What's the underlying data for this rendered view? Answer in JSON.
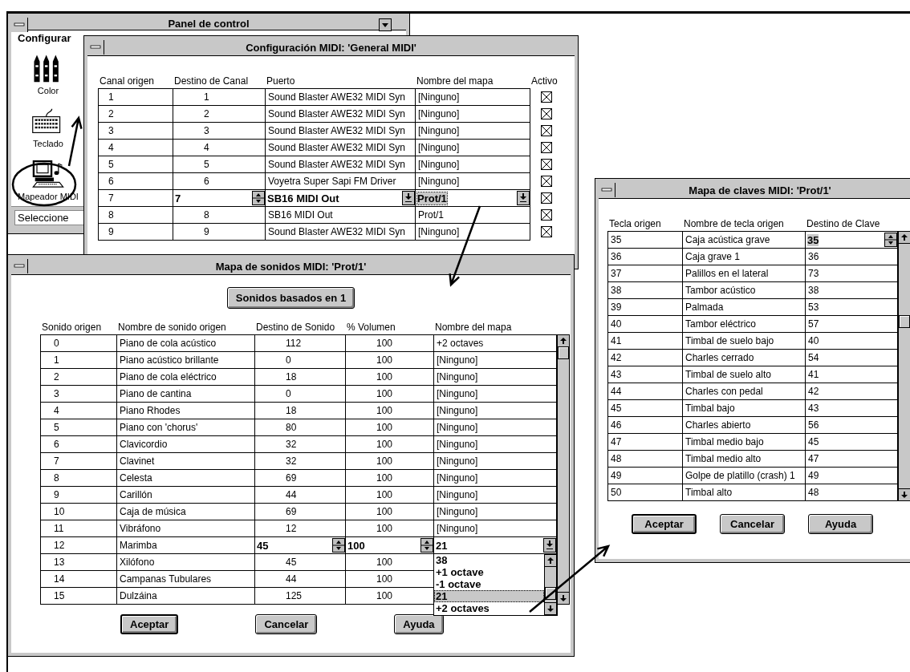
{
  "control_panel": {
    "title": "Panel de control",
    "menu": [
      {
        "label": "Configurar"
      }
    ],
    "icons": [
      {
        "label": "Color",
        "kind": "crayons"
      },
      {
        "label": "Teclado",
        "kind": "keyboard"
      },
      {
        "label": "Mapeador MIDI",
        "kind": "midi"
      }
    ],
    "status": "Seleccione"
  },
  "midi_setup": {
    "title": "Configuración MIDI: 'General MIDI'",
    "columns": [
      {
        "label": "Canal origen"
      },
      {
        "label": "Destino de Canal"
      },
      {
        "label": "Puerto"
      },
      {
        "label": "Nombre del mapa"
      },
      {
        "label": "Activo"
      }
    ],
    "rows": [
      {
        "source": "1",
        "dest": "1",
        "port": "Sound Blaster AWE32 MIDI Syn",
        "map": "[Ninguno]",
        "active": true,
        "editing": false
      },
      {
        "source": "2",
        "dest": "2",
        "port": "Sound Blaster AWE32 MIDI Syn",
        "map": "[Ninguno]",
        "active": true,
        "editing": false
      },
      {
        "source": "3",
        "dest": "3",
        "port": "Sound Blaster AWE32 MIDI Syn",
        "map": "[Ninguno]",
        "active": true,
        "editing": false
      },
      {
        "source": "4",
        "dest": "4",
        "port": "Sound Blaster AWE32 MIDI Syn",
        "map": "[Ninguno]",
        "active": true,
        "editing": false
      },
      {
        "source": "5",
        "dest": "5",
        "port": "Sound Blaster AWE32 MIDI Syn",
        "map": "[Ninguno]",
        "active": true,
        "editing": false
      },
      {
        "source": "6",
        "dest": "6",
        "port": "Voyetra Super Sapi FM Driver",
        "map": "[Ninguno]",
        "active": true,
        "editing": false
      },
      {
        "source": "7",
        "dest": "7",
        "port": "SB16 MIDI Out",
        "map": "Prot/1",
        "active": true,
        "editing": true
      },
      {
        "source": "8",
        "dest": "8",
        "port": "SB16 MIDI Out",
        "map": "Prot/1",
        "active": true,
        "editing": false
      },
      {
        "source": "9",
        "dest": "9",
        "port": "Sound Blaster AWE32 MIDI Syn",
        "map": "[Ninguno]",
        "active": true,
        "editing": false
      }
    ]
  },
  "sound_map": {
    "title": "Mapa de sonidos MIDI: 'Prot/1'",
    "base_button": {
      "label": "Sonidos basados en 1"
    },
    "columns": [
      {
        "label": "Sonido origen"
      },
      {
        "label": "Nombre de sonido origen"
      },
      {
        "label": "Destino de Sonido"
      },
      {
        "label": "% Volumen"
      },
      {
        "label": "Nombre del mapa"
      }
    ],
    "rows": [
      {
        "source": "0",
        "name": "Piano de cola acústico",
        "dest": "112",
        "volume": "100",
        "map": "+2 octaves",
        "editing": false
      },
      {
        "source": "1",
        "name": "Piano acústico brillante",
        "dest": "0",
        "volume": "100",
        "map": "[Ninguno]",
        "editing": false
      },
      {
        "source": "2",
        "name": "Piano de cola eléctrico",
        "dest": "18",
        "volume": "100",
        "map": "[Ninguno]",
        "editing": false
      },
      {
        "source": "3",
        "name": "Piano de cantina",
        "dest": "0",
        "volume": "100",
        "map": "[Ninguno]",
        "editing": false
      },
      {
        "source": "4",
        "name": "Piano Rhodes",
        "dest": "18",
        "volume": "100",
        "map": "[Ninguno]",
        "editing": false
      },
      {
        "source": "5",
        "name": "Piano con 'chorus'",
        "dest": "80",
        "volume": "100",
        "map": "[Ninguno]",
        "editing": false
      },
      {
        "source": "6",
        "name": "Clavicordio",
        "dest": "32",
        "volume": "100",
        "map": "[Ninguno]",
        "editing": false
      },
      {
        "source": "7",
        "name": "Clavinet",
        "dest": "32",
        "volume": "100",
        "map": "[Ninguno]",
        "editing": false
      },
      {
        "source": "8",
        "name": "Celesta",
        "dest": "69",
        "volume": "100",
        "map": "[Ninguno]",
        "editing": false
      },
      {
        "source": "9",
        "name": "Carillón",
        "dest": "44",
        "volume": "100",
        "map": "[Ninguno]",
        "editing": false
      },
      {
        "source": "10",
        "name": "Caja de música",
        "dest": "69",
        "volume": "100",
        "map": "[Ninguno]",
        "editing": false
      },
      {
        "source": "11",
        "name": "Vibráfono",
        "dest": "12",
        "volume": "100",
        "map": "[Ninguno]",
        "editing": false
      },
      {
        "source": "12",
        "name": "Marimba",
        "dest": "45",
        "volume": "100",
        "map": "21",
        "editing": true,
        "dropdown": [
          {
            "label": "38",
            "selected": false
          },
          {
            "label": "+1 octave",
            "selected": false
          },
          {
            "label": "-1 octave",
            "selected": false
          },
          {
            "label": "21",
            "selected": true
          },
          {
            "label": "+2 octaves",
            "selected": false
          }
        ]
      },
      {
        "source": "13",
        "name": "Xilófono",
        "dest": "45",
        "volume": "100",
        "editing": false
      },
      {
        "source": "14",
        "name": "Campanas Tubulares",
        "dest": "44",
        "volume": "100",
        "editing": false
      },
      {
        "source": "15",
        "name": "Dulzáina",
        "dest": "125",
        "volume": "100",
        "editing": false
      }
    ],
    "buttons": [
      {
        "label": "Aceptar",
        "default": true
      },
      {
        "label": "Cancelar",
        "default": false
      },
      {
        "label": "Ayuda",
        "default": false
      }
    ]
  },
  "key_map": {
    "title": "Mapa de claves MIDI: 'Prot/1'",
    "columns": [
      {
        "label": "Tecla origen"
      },
      {
        "label": "Nombre de tecla origen"
      },
      {
        "label": "Destino de Clave"
      }
    ],
    "rows": [
      {
        "source": "35",
        "name": "Caja acústica grave",
        "dest": "35",
        "editing": true
      },
      {
        "source": "36",
        "name": "Caja grave 1",
        "dest": "36",
        "editing": false
      },
      {
        "source": "37",
        "name": "Palillos en el lateral",
        "dest": "73",
        "editing": false
      },
      {
        "source": "38",
        "name": "Tambor acústico",
        "dest": "38",
        "editing": false
      },
      {
        "source": "39",
        "name": "Palmada",
        "dest": "53",
        "editing": false
      },
      {
        "source": "40",
        "name": "Tambor eléctrico",
        "dest": "57",
        "editing": false
      },
      {
        "source": "41",
        "name": "Timbal de suelo bajo",
        "dest": "40",
        "editing": false
      },
      {
        "source": "42",
        "name": "Charles cerrado",
        "dest": "54",
        "editing": false
      },
      {
        "source": "43",
        "name": "Timbal de suelo alto",
        "dest": "41",
        "editing": false
      },
      {
        "source": "44",
        "name": "Charles con pedal",
        "dest": "42",
        "editing": false
      },
      {
        "source": "45",
        "name": "Timbal bajo",
        "dest": "43",
        "editing": false
      },
      {
        "source": "46",
        "name": "Charles abierto",
        "dest": "56",
        "editing": false
      },
      {
        "source": "47",
        "name": "Timbal medio bajo",
        "dest": "45",
        "editing": false
      },
      {
        "source": "48",
        "name": "Timbal medio alto",
        "dest": "47",
        "editing": false
      },
      {
        "source": "49",
        "name": "Golpe de platillo (crash) 1",
        "dest": "49",
        "editing": false
      },
      {
        "source": "50",
        "name": "Timbal alto",
        "dest": "48",
        "editing": false
      }
    ],
    "buttons": [
      {
        "label": "Aceptar",
        "default": true
      },
      {
        "label": "Cancelar",
        "default": false
      },
      {
        "label": "Ayuda",
        "default": false
      }
    ]
  }
}
